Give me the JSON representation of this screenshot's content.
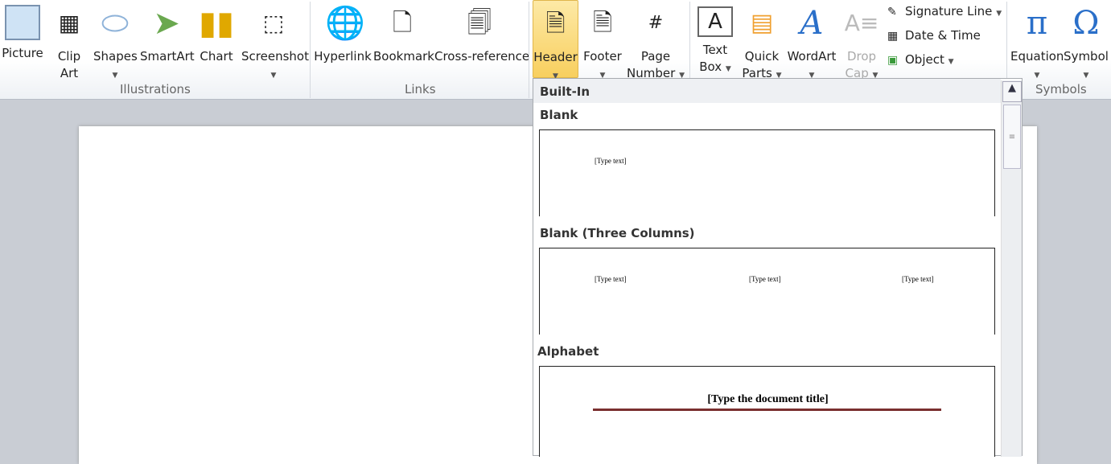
{
  "ribbon": {
    "illustrations": {
      "label": "Illustrations",
      "picture": "Picture",
      "clip_art_1": "Clip",
      "clip_art_2": "Art",
      "shapes": "Shapes",
      "smartart": "SmartArt",
      "chart": "Chart",
      "screenshot": "Screenshot"
    },
    "links": {
      "label": "Links",
      "hyperlink": "Hyperlink",
      "bookmark": "Bookmark",
      "cross_reference": "Cross-reference"
    },
    "header_footer": {
      "header": "Header",
      "footer": "Footer",
      "page_number_1": "Page",
      "page_number_2": "Number"
    },
    "text": {
      "text_box_1": "Text",
      "text_box_2": "Box",
      "quick_parts_1": "Quick",
      "quick_parts_2": "Parts",
      "wordart": "WordArt",
      "drop_cap_1": "Drop",
      "drop_cap_2": "Cap",
      "signature_line": "Signature Line",
      "date_time": "Date & Time",
      "object": "Object"
    },
    "symbols": {
      "label": "Symbols",
      "equation": "Equation",
      "symbol": "Symbol"
    }
  },
  "dropdown": {
    "category": "Built-In",
    "items": [
      {
        "name": "Blank",
        "texts": [
          "[Type text]"
        ]
      },
      {
        "name": "Blank (Three Columns)",
        "texts": [
          "[Type text]",
          "[Type text]",
          "[Type text]"
        ]
      },
      {
        "name": "Alphabet",
        "texts": [
          "[Type the document title]"
        ]
      }
    ]
  },
  "colors": {
    "header_highlight": "#f8cf5e",
    "alphabet_rule": "#7a2f2f"
  }
}
